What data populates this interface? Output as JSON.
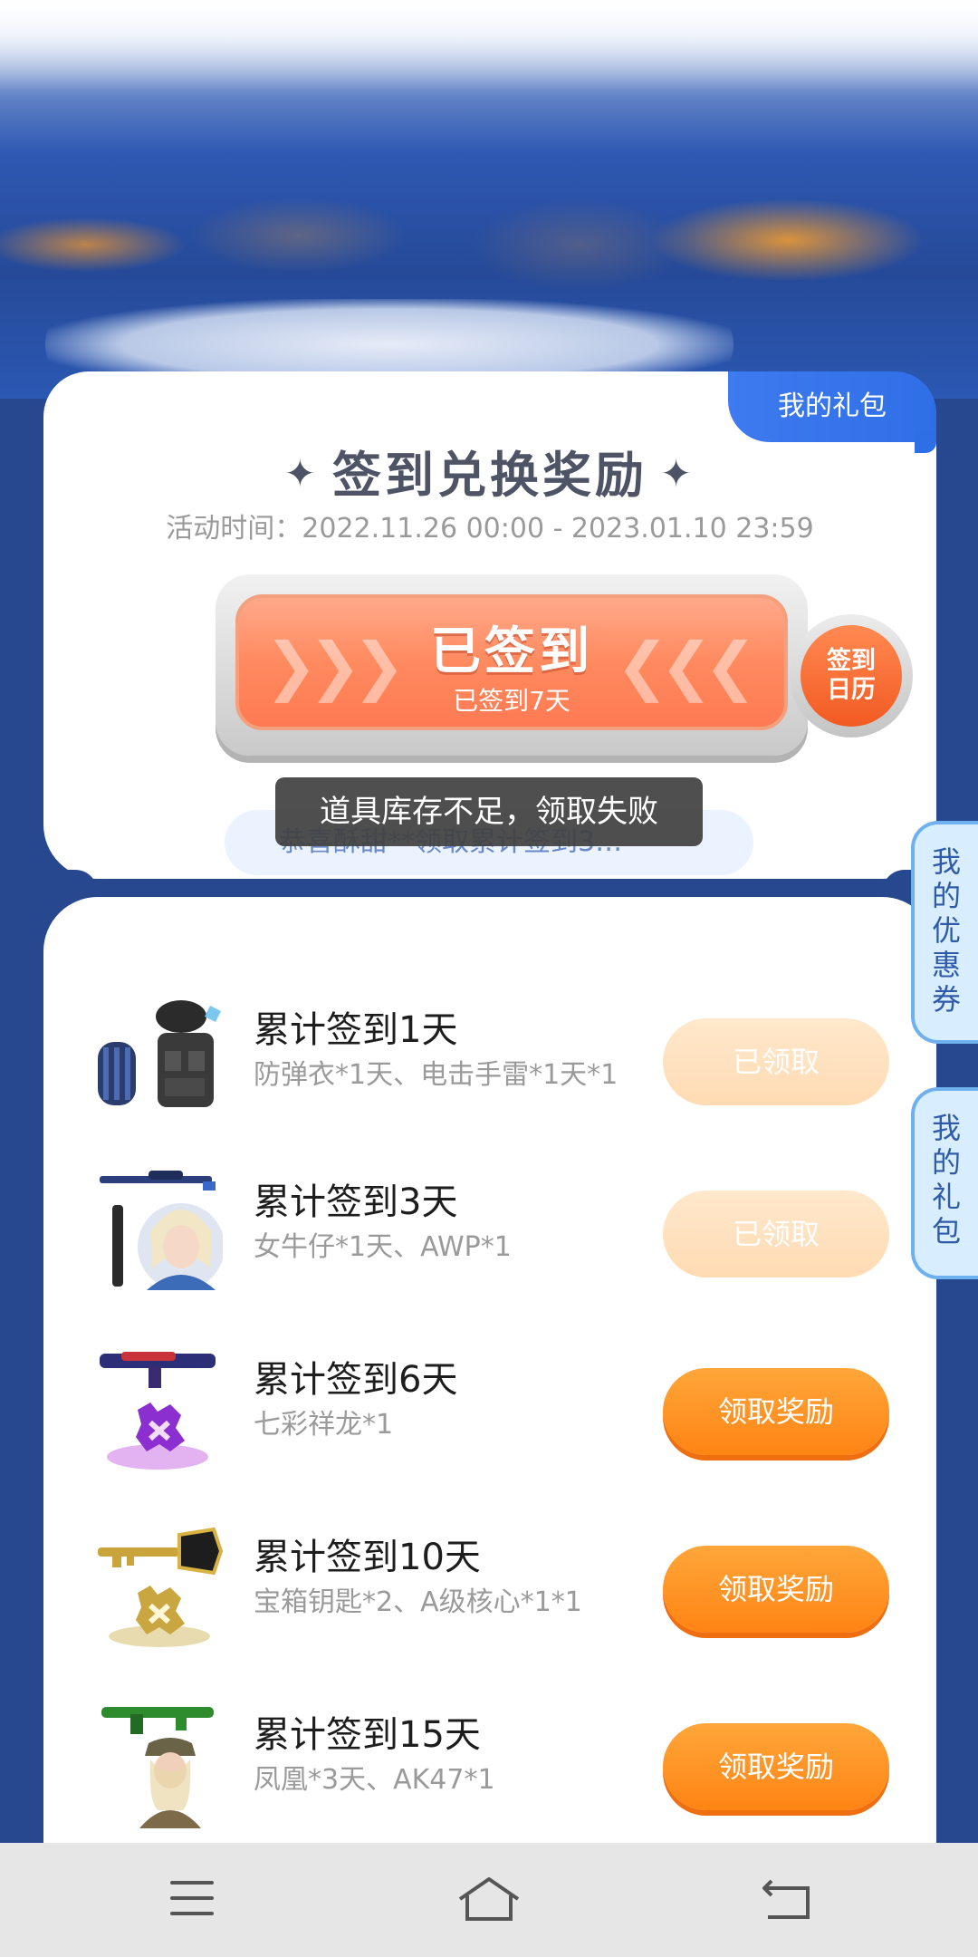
{
  "header": {
    "my_gift_tab": "我的礼包",
    "title": "签到兑换奖励",
    "activity_time": "活动时间：2022.11.26 00:00 - 2023.01.10 23:59"
  },
  "signin": {
    "label": "已签到",
    "sub_label": "已签到7天",
    "calendar_label_line1": "签到",
    "calendar_label_line2": "日历"
  },
  "marquee": "恭喜酥甜**领取累计签到3…",
  "toast": "道具库存不足，领取失败",
  "side_tabs": {
    "coupons": "我的优惠券",
    "gifts": "我的礼包"
  },
  "rewards": [
    {
      "title": "累计签到1天",
      "desc": "防弹衣*1天、电击手雷*1天*1",
      "button": "已领取",
      "state": "claimed",
      "icon": "armor-grenade-icon"
    },
    {
      "title": "累计签到3天",
      "desc": "女牛仔*1天、AWP*1",
      "button": "已领取",
      "state": "claimed",
      "icon": "cowgirl-awp-icon"
    },
    {
      "title": "累计签到6天",
      "desc": "七彩祥龙*1",
      "button": "领取奖励",
      "state": "available",
      "icon": "rainbow-dragon-gun-icon"
    },
    {
      "title": "累计签到10天",
      "desc": "宝箱钥匙*2、A级核心*1*1",
      "button": "领取奖励",
      "state": "available",
      "icon": "chest-key-icon"
    },
    {
      "title": "累计签到15天",
      "desc": "凤凰*3天、AK47*1",
      "button": "领取奖励",
      "state": "available",
      "icon": "phoenix-ak47-icon"
    }
  ],
  "colors": {
    "page_bg": "#27478e",
    "accent_orange": "#ff8414",
    "claimed_peach": "#ffdbb3",
    "tab_blue": "#2f6fe6"
  }
}
